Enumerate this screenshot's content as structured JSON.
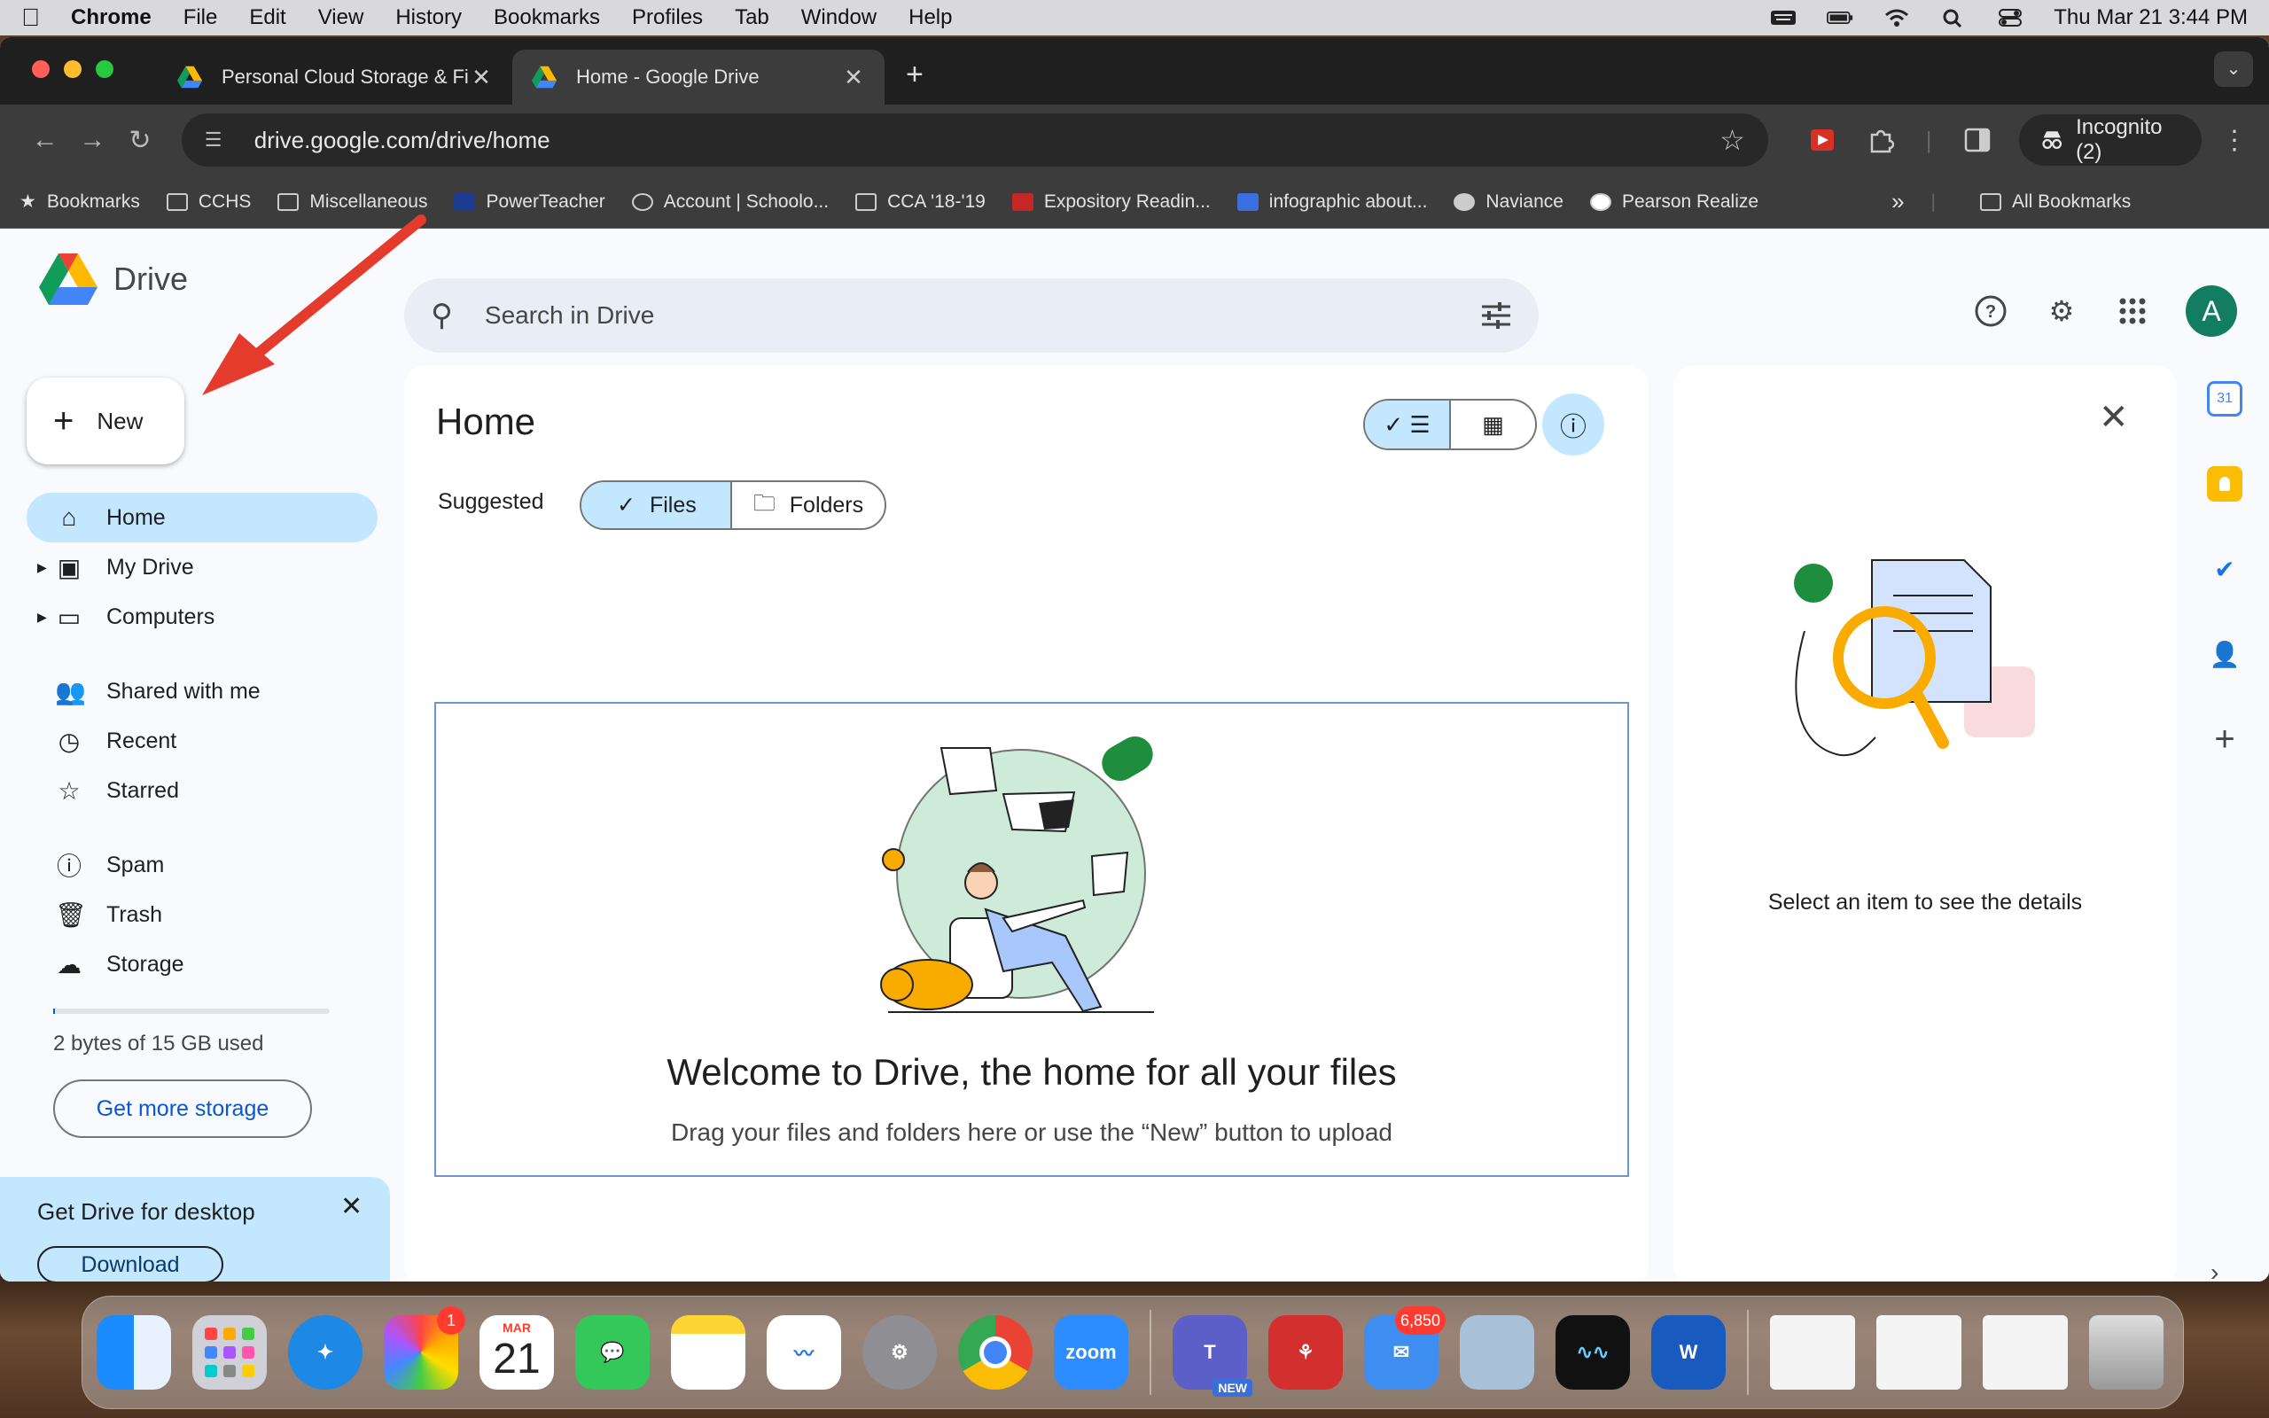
{
  "menubar": {
    "app": "Chrome",
    "items": [
      "File",
      "Edit",
      "View",
      "History",
      "Bookmarks",
      "Profiles",
      "Tab",
      "Window",
      "Help"
    ],
    "datetime": "Thu Mar 21  3:44 PM"
  },
  "tabs": [
    {
      "title": "Personal Cloud Storage & File",
      "close": "✕"
    },
    {
      "title": "Home - Google Drive",
      "close": "✕"
    }
  ],
  "toolbar": {
    "url": "drive.google.com/drive/home",
    "incognito": "Incognito (2)"
  },
  "bookmarks": {
    "items": [
      {
        "label": "Bookmarks",
        "icon": "star-icon"
      },
      {
        "label": "CCHS",
        "icon": "folder-icon"
      },
      {
        "label": "Miscellaneous",
        "icon": "folder-icon"
      },
      {
        "label": "PowerTeacher",
        "icon": "sis-icon"
      },
      {
        "label": "Account | Schoolo...",
        "icon": "schoology-icon"
      },
      {
        "label": "CCA '18-'19",
        "icon": "folder-icon"
      },
      {
        "label": "Expository Readin...",
        "icon": "csu-icon"
      },
      {
        "label": "infographic about...",
        "icon": "page-icon"
      },
      {
        "label": "Naviance",
        "icon": "globe-icon"
      },
      {
        "label": "Pearson Realize",
        "icon": "pearson-icon"
      }
    ],
    "more": "»",
    "all": "All Bookmarks"
  },
  "drive": {
    "brand": "Drive",
    "search_placeholder": "Search in Drive",
    "avatar": "A",
    "new_label": "New",
    "nav": [
      {
        "label": "Home",
        "icon": "home-icon",
        "active": true
      },
      {
        "label": "My Drive",
        "icon": "my-drive-icon"
      },
      {
        "label": "Computers",
        "icon": "computers-icon"
      },
      {
        "label": "Shared with me",
        "icon": "shared-icon"
      },
      {
        "label": "Recent",
        "icon": "clock-icon"
      },
      {
        "label": "Starred",
        "icon": "star-icon"
      },
      {
        "label": "Spam",
        "icon": "spam-icon"
      },
      {
        "label": "Trash",
        "icon": "trash-icon"
      },
      {
        "label": "Storage",
        "icon": "cloud-icon"
      }
    ],
    "storage_used": "2 bytes of 15 GB used",
    "storage_fraction": 0.0,
    "get_storage": "Get more storage",
    "promo": {
      "title": "Get Drive for desktop",
      "download": "Download"
    },
    "main": {
      "title": "Home",
      "suggested": "Suggested",
      "chips": [
        "Files",
        "Folders"
      ],
      "welcome_title": "Welcome to Drive, the home for all your files",
      "welcome_sub": "Drag your files and folders here or use the “New” button to upload"
    },
    "details": {
      "text": "Select an item to see the details"
    }
  },
  "dock": {
    "apps": [
      "Finder",
      "Launchpad",
      "Safari",
      "Photos",
      "Calendar",
      "Messages",
      "Notes",
      "Freeform",
      "System Settings",
      "Chrome",
      "Zoom",
      "Teams",
      "Acrobat",
      "Mail",
      "Preview",
      "Notchmeister",
      "Word"
    ],
    "photos_badge": "1",
    "calendar_month": "MAR",
    "calendar_day": "21",
    "mail_badge": "6,850",
    "zoom_label": "zoom",
    "teams_badge": "NEW"
  },
  "colors": {
    "accent": "#0b57d0",
    "active_nav": "#c2e7ff",
    "annotation": "#e53b2c"
  }
}
